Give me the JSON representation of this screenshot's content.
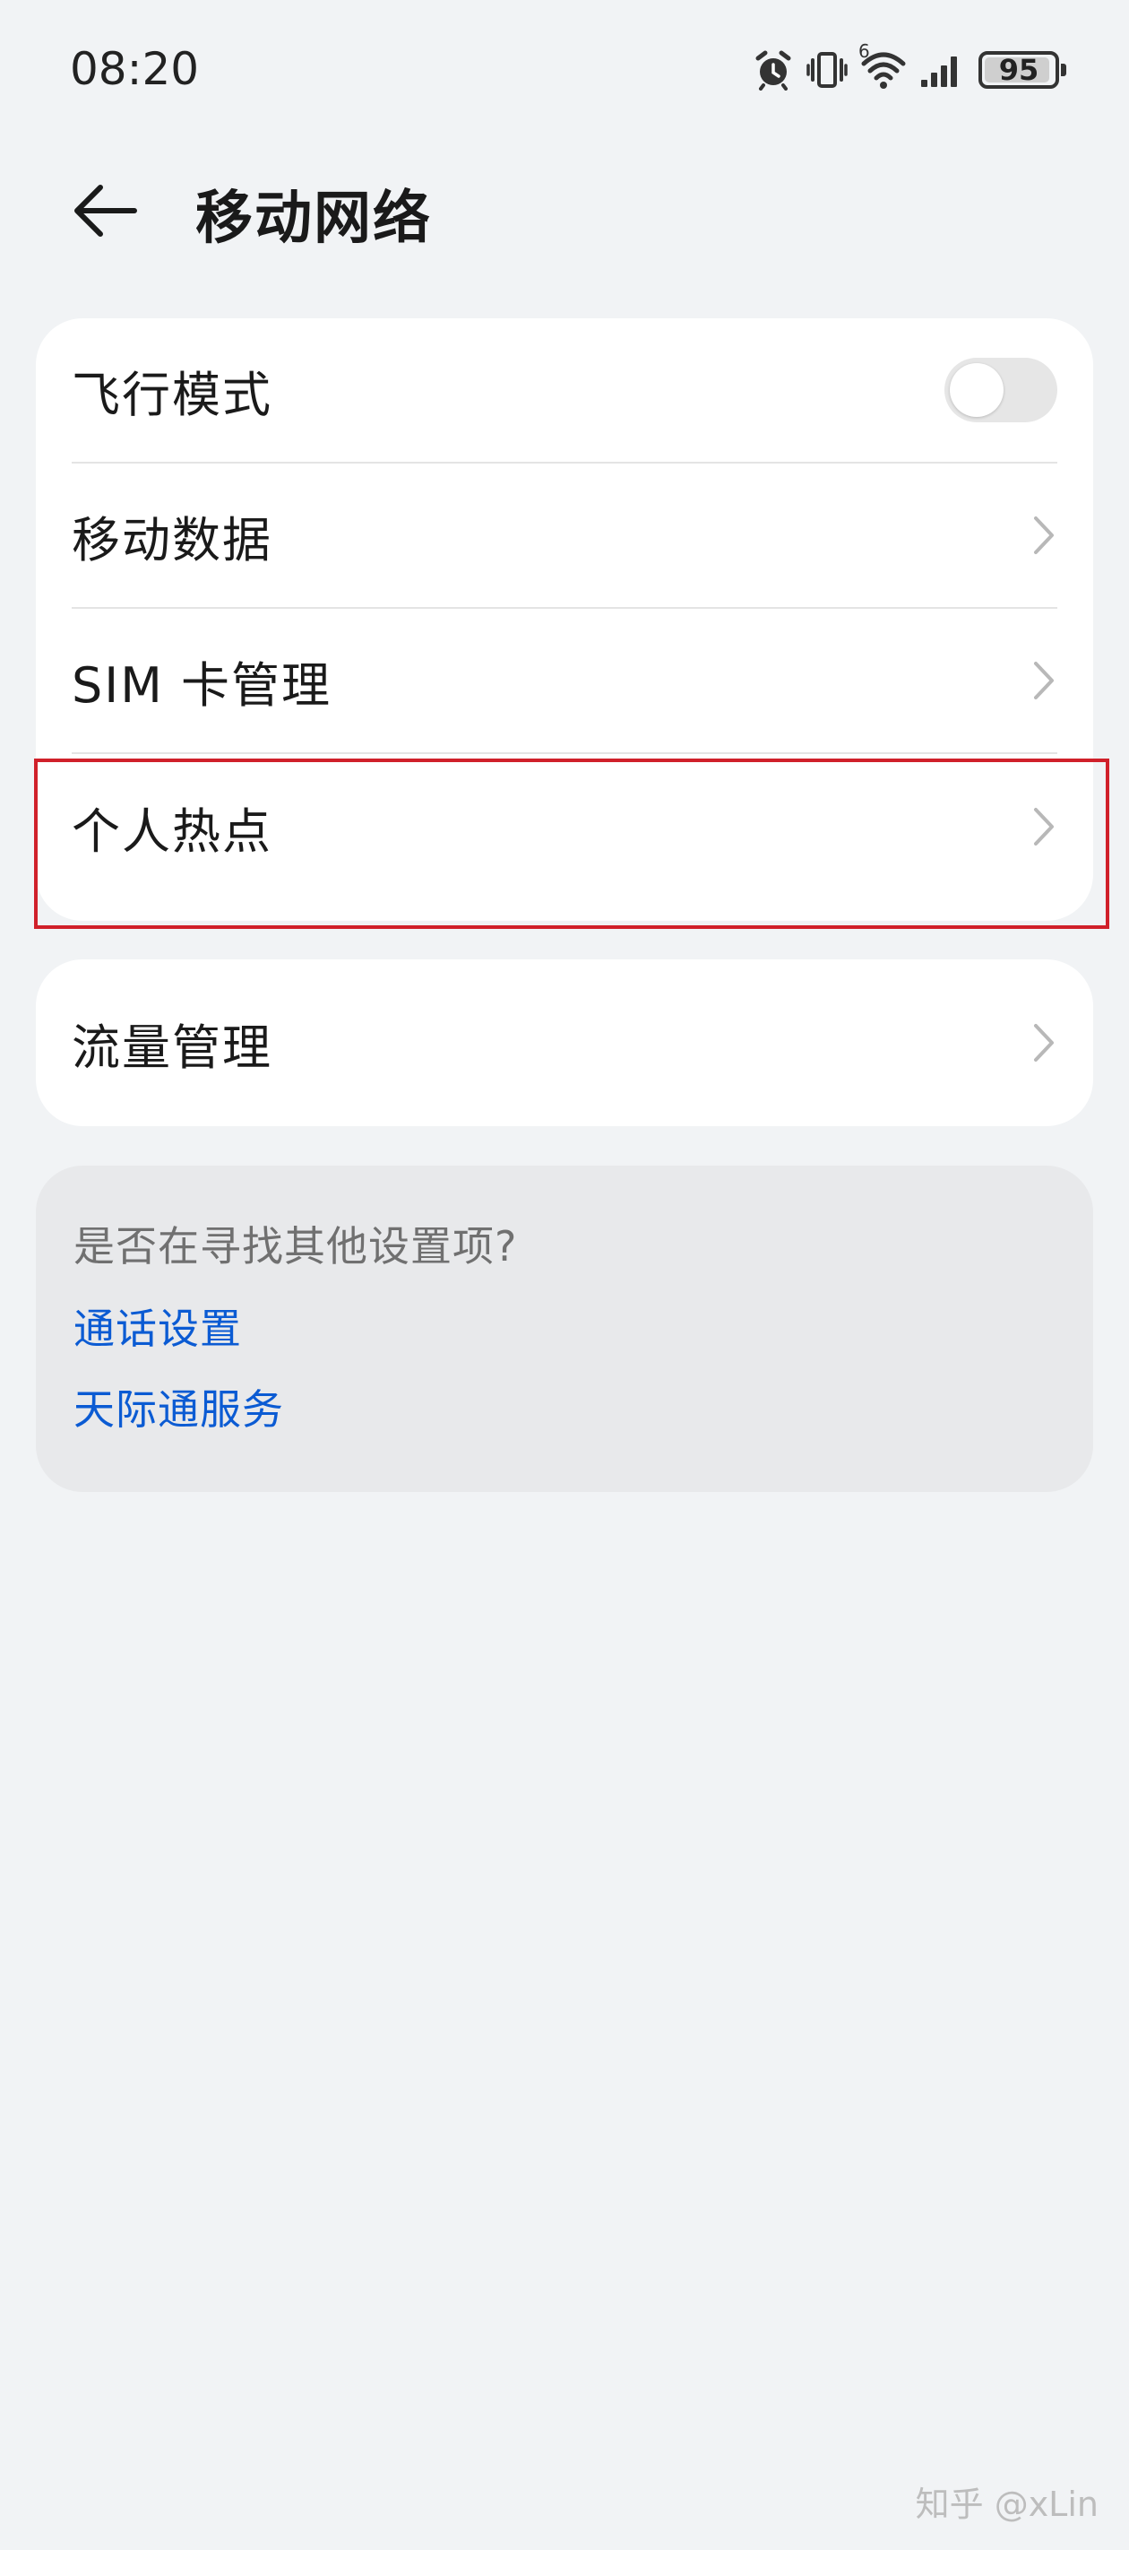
{
  "status_bar": {
    "time": "08:20",
    "signal_label": "6",
    "battery": "95",
    "battery_level": 0.95,
    "icons": [
      "alarm-icon",
      "vibrate-icon",
      "wifi-icon",
      "cellular-signal-icon",
      "battery-icon"
    ]
  },
  "header": {
    "title": "移动网络",
    "back_icon": "back-arrow-icon"
  },
  "group1": {
    "airplane_mode": {
      "label": "飞行模式",
      "on": false
    },
    "mobile_data": {
      "label": "移动数据"
    },
    "sim_management": {
      "label": "SIM 卡管理"
    },
    "personal_hotspot": {
      "label": "个人热点"
    }
  },
  "group2": {
    "data_usage": {
      "label": "流量管理"
    }
  },
  "suggestions": {
    "question": "是否在寻找其他设置项?",
    "links": [
      {
        "label": "通话设置"
      },
      {
        "label": "天际通服务"
      }
    ]
  },
  "colors": {
    "background": "#f1f3f5",
    "card": "#ffffff",
    "link": "#0b5bd3",
    "highlight": "#d0202a"
  },
  "watermark": "知乎 @xLin"
}
